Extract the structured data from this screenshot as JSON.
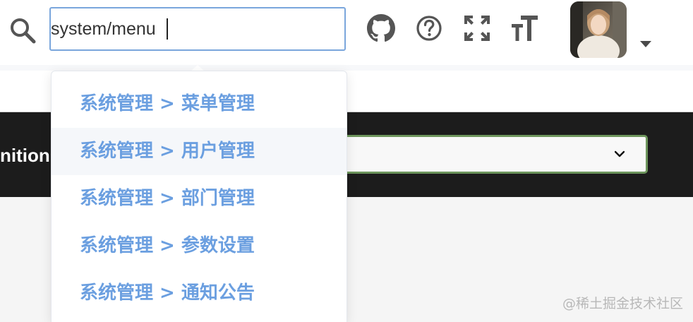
{
  "header": {
    "search_value": "system/menu",
    "icons": [
      "search-icon",
      "github-icon",
      "help-icon",
      "fullscreen-icon",
      "font-size-icon"
    ],
    "avatar_caret": "caret-down-icon"
  },
  "dropdown": {
    "items": [
      {
        "label": "系统管理 > 菜单管理"
      },
      {
        "label": "系统管理 > 用户管理"
      },
      {
        "label": "系统管理 > 部门管理"
      },
      {
        "label": "系统管理 > 参数设置"
      },
      {
        "label": "系统管理 > 通知公告"
      }
    ],
    "highlighted_index": 1
  },
  "background": {
    "partial_label": "nition"
  },
  "watermark": "@稀土掘金技术社区",
  "colors": {
    "link_blue": "#6b9fe0",
    "input_border": "#7aa6dc",
    "select_border": "#6d955c",
    "dark_band": "#1c1c1c"
  }
}
